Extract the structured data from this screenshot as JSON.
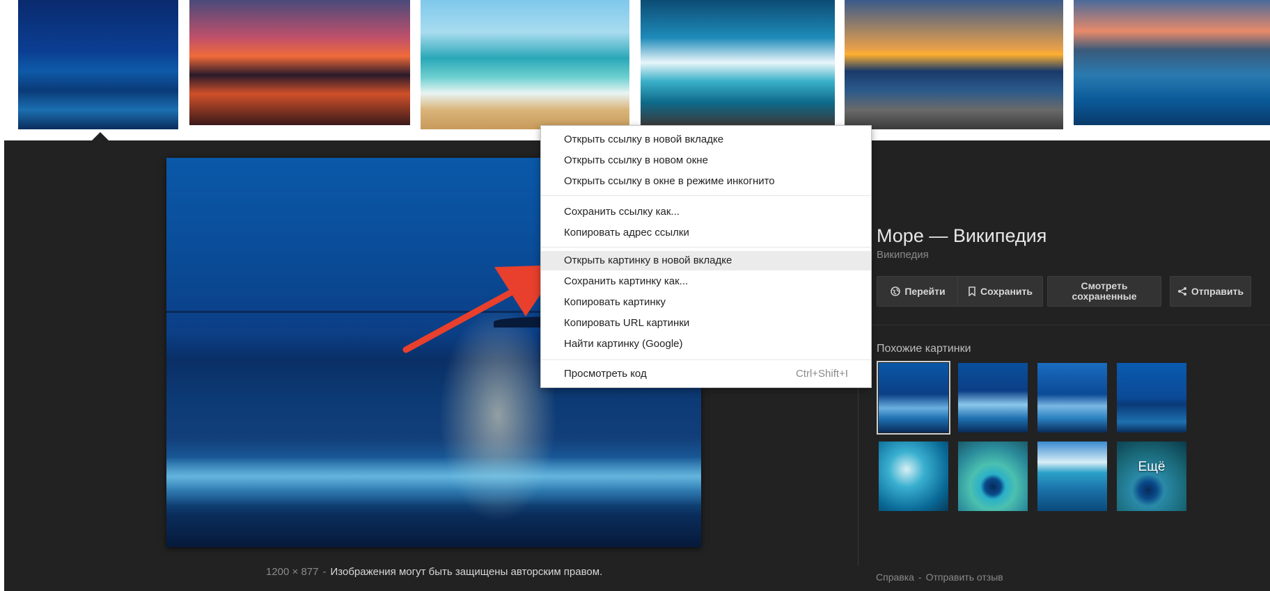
{
  "thumbnails": [
    {
      "alt": "moonlit sea"
    },
    {
      "alt": "red sunset over sea"
    },
    {
      "alt": "turquoise beach waves"
    },
    {
      "alt": "crashing turquoise wave"
    },
    {
      "alt": "sunset over pebble beach"
    },
    {
      "alt": "woman walking in sea at sunset"
    }
  ],
  "preview": {
    "dimensions": "1200 × 877",
    "separator": "-",
    "copyright_notice": "Изображения могут быть защищены авторским правом."
  },
  "info": {
    "title": "Море — Википедия",
    "source": "Википедия",
    "buttons": {
      "go": "Перейти",
      "save": "Сохранить",
      "view_saved": "Смотреть сохраненные",
      "share": "Отправить"
    },
    "similar_title": "Похожие картинки",
    "more_label": "Ещё"
  },
  "footer": {
    "help": "Справка",
    "separator": "-",
    "feedback": "Отправить отзыв"
  },
  "context_menu": {
    "items": [
      "Открыть ссылку в новой вкладке",
      "Открыть ссылку в новом окне",
      "Открыть ссылку в окне в режиме инкогнито",
      "Сохранить ссылку как...",
      "Копировать адрес ссылки",
      "Открыть картинку в новой вкладке",
      "Сохранить картинку как...",
      "Копировать картинку",
      "Копировать URL картинки",
      "Найти картинку (Google)",
      "Просмотреть код"
    ],
    "inspect_shortcut": "Ctrl+Shift+I",
    "highlighted_item": "Открыть картинку в новой вкладке"
  },
  "colors": {
    "panel_background": "#222222",
    "annotation_arrow": "#e8402c",
    "menu_highlight": "#ebebeb"
  },
  "icons": {
    "go": "globe-icon",
    "save": "bookmark-icon",
    "share": "share-icon"
  }
}
